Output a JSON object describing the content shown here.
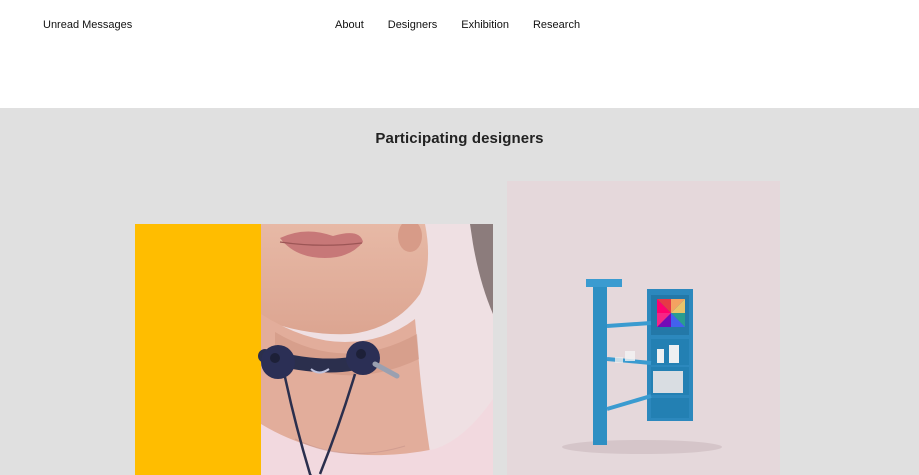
{
  "header": {
    "logo": "Unread Messages",
    "nav": [
      "About",
      "Designers",
      "Exhibition",
      "Research"
    ]
  },
  "main": {
    "title": "Participating designers"
  },
  "colors": {
    "accent_yellow": "#ffbd00",
    "section_bg": "#e0e0e0"
  }
}
